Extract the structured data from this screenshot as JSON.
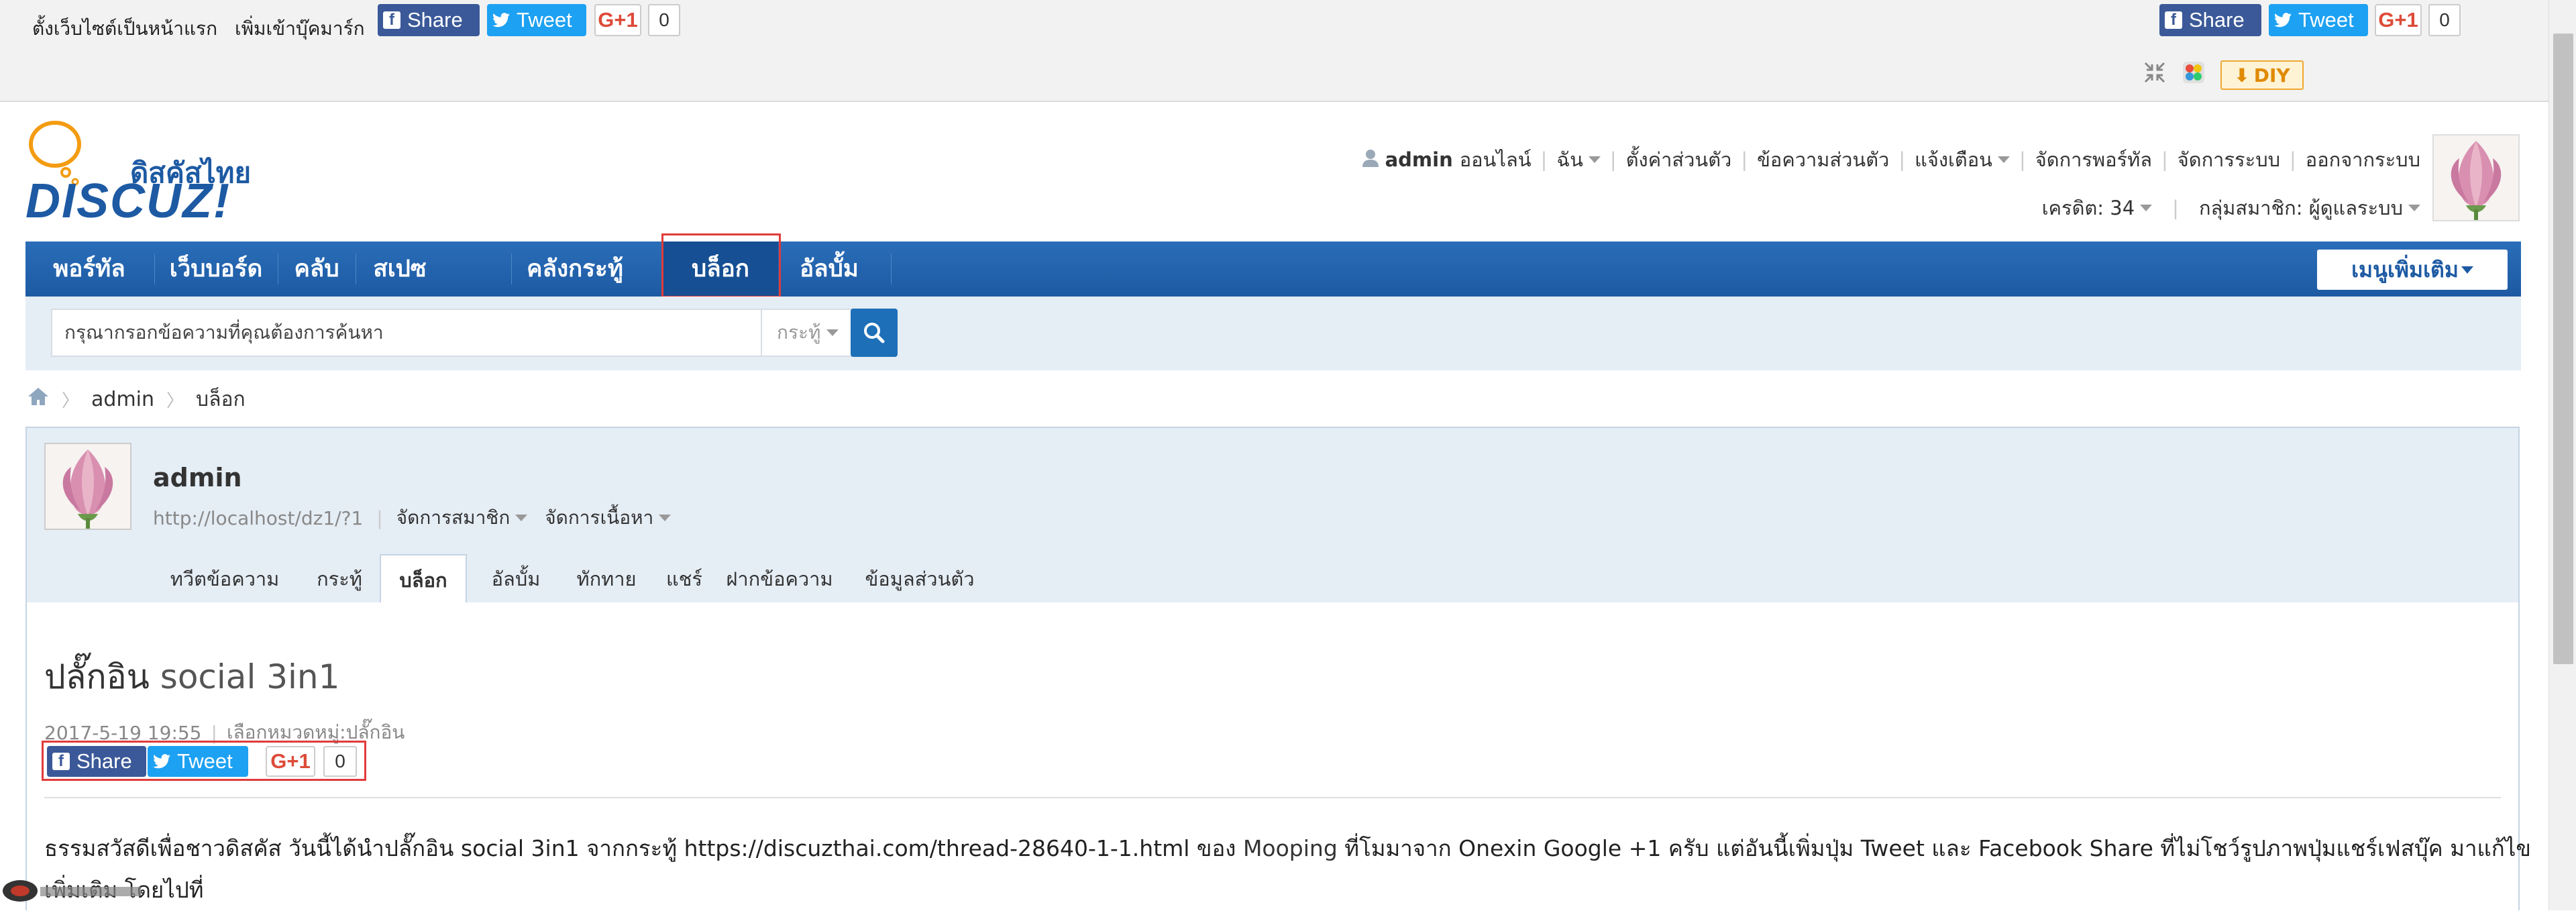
{
  "topbar": {
    "set_homepage": "ตั้งเว็บไซต์เป็นหน้าแรก",
    "add_bookmark": "เพิ่มเข้าบุ๊คมาร์ก",
    "share_label": "Share",
    "tweet_label": "Tweet",
    "gplus_label": "G+1",
    "gplus_count": "0",
    "diy_label": "DIY"
  },
  "logo": {
    "text_thai": "ดิสคัสไทย",
    "text_brand": "DISCUZ!"
  },
  "userbar": {
    "username": "admin",
    "status": "ออนไลน์",
    "items": [
      "ฉัน",
      "ตั้งค่าส่วนตัว",
      "ข้อความส่วนตัว",
      "แจ้งเตือน",
      "จัดการพอร์ทัล",
      "จัดการระบบ",
      "ออกจากระบบ"
    ],
    "credit": "เครดิต: 34",
    "group": "กลุ่มสมาชิก: ผู้ดูแลระบบ"
  },
  "nav": {
    "items": [
      "พอร์ทัล",
      "เว็บบอร์ด",
      "คลับ",
      "สเปซ",
      "คลังกระทู้",
      "บล็อก",
      "อัลบั้ม"
    ],
    "active": "บล็อก",
    "more_menu": "เมนูเพิ่มเติม"
  },
  "search": {
    "placeholder": "กรุณากรอกข้อความที่คุณต้องการค้นหา",
    "scope": "กระทู้"
  },
  "breadcrumb": [
    "admin",
    "บล็อก"
  ],
  "profile": {
    "name": "admin",
    "url": "http://localhost/dz1/?1",
    "manage_member": "จัดการสมาชิก",
    "manage_content": "จัดการเนื้อหา",
    "tabs": [
      "ทวีตข้อความ",
      "กระทู้",
      "บล็อก",
      "อัลบั้ม",
      "ทักทาย",
      "แชร์",
      "ฝากข้อความ",
      "ข้อมูลส่วนตัว"
    ],
    "active_tab": "บล็อก"
  },
  "post": {
    "title_thai": "ปลั๊กอิน",
    "title_en": "social 3in1",
    "date": "2017-5-19 19:55",
    "category": "เลือกหมวดหมู่:ปลั๊กอิน",
    "body_part1": "ธรรมสวัสดีเพื่อชาวดิสคัส  วันนี้ได้นำปลั๊กอิน  social 3in1 จากกระทู้ https://discuzthai.com/thread-28640-1-1.html ของ",
    "body_link": "Mooping",
    "body_part2": "ที่โมมาจาก Onexin Google +1 ครับ แต่อันนี้เพิ่มปุ่ม Tweet และ Facebook Share ที่ไม่โชว์รูปภาพปุ่มแชร์เฟสบุ๊ค มาแก้ไข",
    "body_line2": "เพิ่มเติม โดยไปที่"
  }
}
